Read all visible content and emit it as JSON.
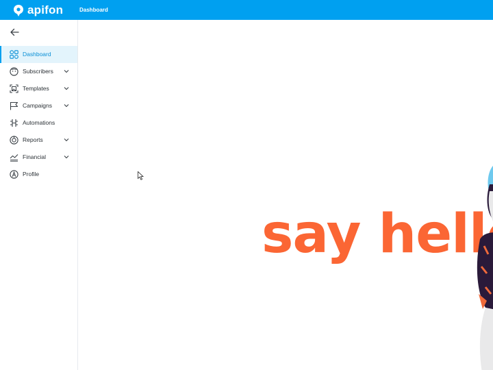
{
  "app": {
    "brand": "apifon"
  },
  "header": {
    "breadcrumb": "Dashboard"
  },
  "sidebar": {
    "items": [
      {
        "label": "Dashboard",
        "icon": "dashboard-icon",
        "active": true,
        "expandable": false
      },
      {
        "label": "Subscribers",
        "icon": "subscribers-icon",
        "active": false,
        "expandable": true
      },
      {
        "label": "Templates",
        "icon": "templates-icon",
        "active": false,
        "expandable": true
      },
      {
        "label": "Campaigns",
        "icon": "campaigns-icon",
        "active": false,
        "expandable": true
      },
      {
        "label": "Automations",
        "icon": "automations-icon",
        "active": false,
        "expandable": false
      },
      {
        "label": "Reports",
        "icon": "reports-icon",
        "active": false,
        "expandable": true
      },
      {
        "label": "Financial",
        "icon": "financial-icon",
        "active": false,
        "expandable": true
      },
      {
        "label": "Profile",
        "icon": "profile-icon",
        "active": false,
        "expandable": false
      }
    ]
  },
  "main": {
    "banner_text": "say hello"
  },
  "colors": {
    "brand": "#00a0f0",
    "accent": "#fb6634",
    "active_bg": "#e3f4fc",
    "text": "#2b3136"
  }
}
